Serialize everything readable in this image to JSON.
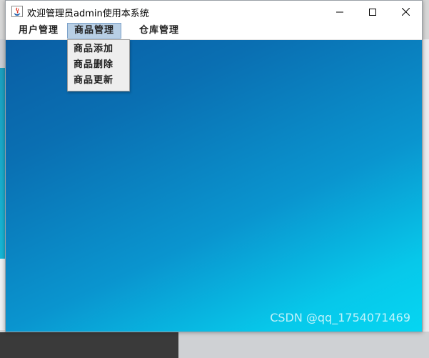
{
  "window": {
    "title": "欢迎管理员admin使用本系统"
  },
  "controls": {
    "minimize_icon": "minimize-icon",
    "maximize_icon": "maximize-icon",
    "close_icon": "close-icon"
  },
  "menubar": {
    "items": [
      {
        "label": "用户管理"
      },
      {
        "label": "商品管理"
      },
      {
        "label": "仓库管理"
      }
    ]
  },
  "dropdown": {
    "items": [
      {
        "label": "商品添加"
      },
      {
        "label": "商品删除"
      },
      {
        "label": "商品更新"
      }
    ]
  },
  "watermark": "CSDN @qq_1754071469",
  "colors": {
    "content_gradient_start": "#0a5ea4",
    "content_gradient_end": "#05d6f2",
    "menu_active": "#b8cfe5"
  }
}
